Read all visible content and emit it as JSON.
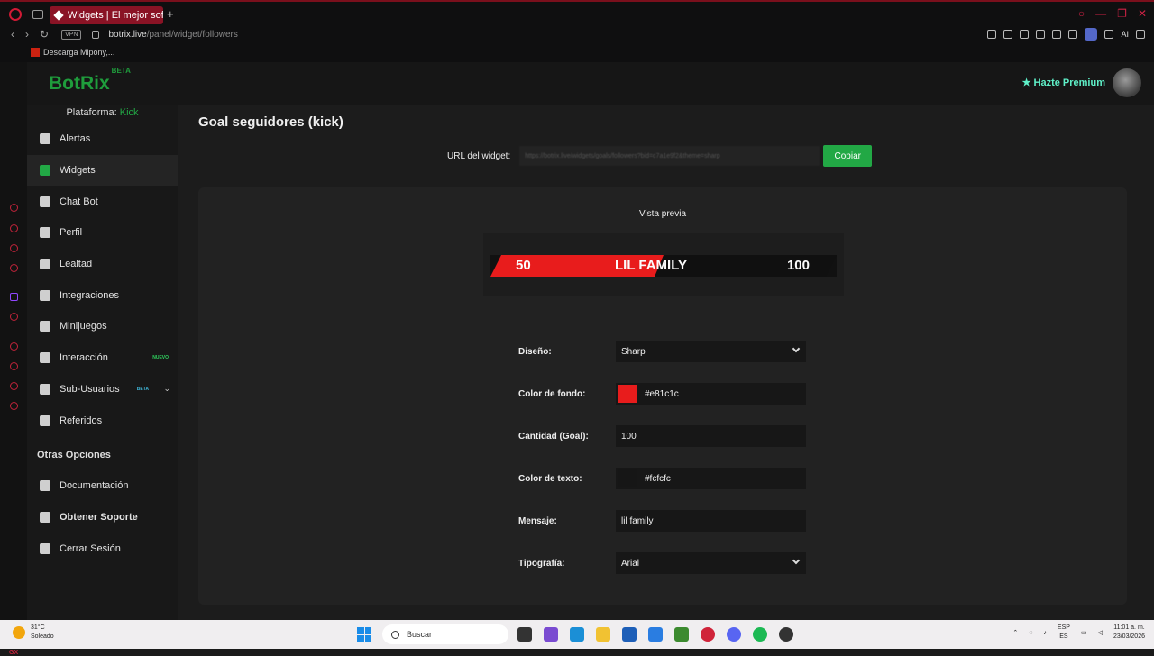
{
  "browser": {
    "tab_title": "Widgets | El mejor software",
    "url_host": "botrix.live",
    "url_path": "/panel/widget/followers",
    "vpn_label": "VPN",
    "ai_label": "AI",
    "bookmark": "Descarga Mipony,..."
  },
  "app": {
    "logo": "BotRix",
    "logo_badge": "BETA",
    "premium_label": "Hazte Premium"
  },
  "sidebar": {
    "platform_label": "Plataforma:",
    "platform_value": "Kick",
    "items": [
      {
        "label": "Alertas",
        "icon": "warning-icon"
      },
      {
        "label": "Widgets",
        "icon": "grid-icon",
        "active": true
      },
      {
        "label": "Chat Bot",
        "icon": "robot-icon"
      },
      {
        "label": "Perfil",
        "icon": "id-card-icon"
      },
      {
        "label": "Lealtad",
        "icon": "trophy-icon"
      },
      {
        "label": "Integraciones",
        "icon": "plug-icon"
      },
      {
        "label": "Minijuegos",
        "icon": "gamepad-icon"
      },
      {
        "label": "Interacción",
        "icon": "music-icon",
        "badge": "NUEVO"
      },
      {
        "label": "Sub-Usuarios",
        "icon": "users-icon",
        "badge": "BETA"
      },
      {
        "label": "Referidos",
        "icon": "user-friends-icon"
      }
    ],
    "other_title": "Otras Opciones",
    "other_items": [
      {
        "label": "Documentación",
        "icon": "book-icon"
      },
      {
        "label": "Obtener Soporte",
        "icon": "question-icon"
      },
      {
        "label": "Cerrar Sesión",
        "icon": "logout-icon"
      }
    ]
  },
  "main": {
    "title": "Goal seguidores (kick)",
    "widget_url_label": "URL del widget:",
    "widget_url_value": "https://botrix.live/widgets/goals/followers?bid=c7a1e9f2&theme=sharp",
    "copy_label": "Copiar",
    "preview_label": "Vista previa",
    "preview": {
      "current": "50",
      "goal": "100",
      "message": "LIL FAMILY",
      "progress": 0.5,
      "bg_color": "#e81c1c",
      "text_color": "#fcfcfc"
    },
    "form": [
      {
        "label": "Diseño:",
        "value": "Sharp",
        "type": "select"
      },
      {
        "label": "Color de fondo:",
        "value": "#e81c1c",
        "type": "color",
        "swatch": "#e81c1c"
      },
      {
        "label": "Cantidad (Goal):",
        "value": "100",
        "type": "number"
      },
      {
        "label": "Color de texto:",
        "value": "#fcfcfc",
        "type": "color",
        "swatch": "#161616"
      },
      {
        "label": "Mensaje:",
        "value": "lil family",
        "type": "text"
      },
      {
        "label": "Tipografía:",
        "value": "Arial",
        "type": "select"
      }
    ]
  },
  "taskbar": {
    "temperature": "31°C",
    "weather": "Soleado",
    "search_label": "Buscar",
    "lang_1": "ESP",
    "lang_2": "ES",
    "time": "11:01 a. m.",
    "date": "23/03/2026"
  }
}
